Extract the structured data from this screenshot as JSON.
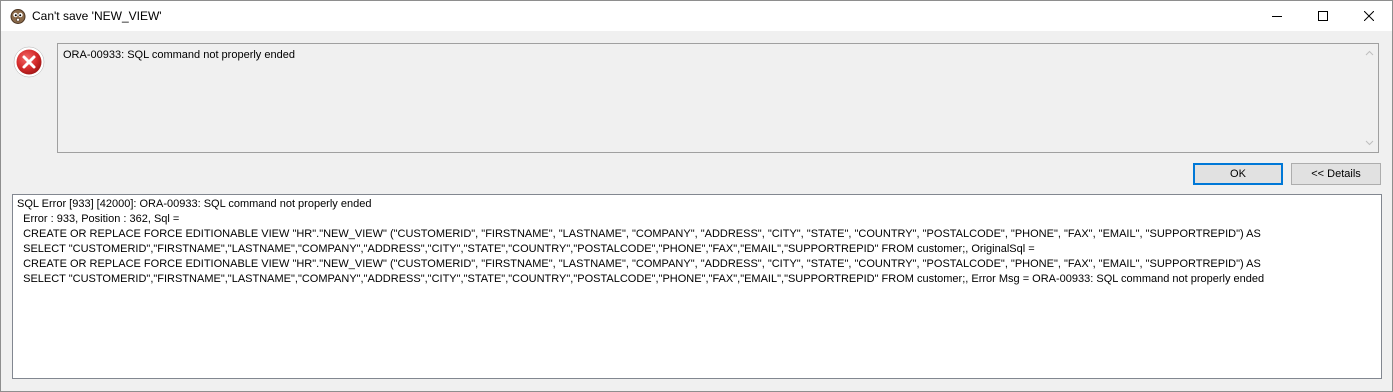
{
  "window": {
    "title": "Can't save 'NEW_VIEW'",
    "controls": {
      "minimize": "minimize-icon",
      "maximize": "maximize-icon",
      "close": "close-icon"
    }
  },
  "message": {
    "icon": "error-icon",
    "text": "ORA-00933: SQL command not properly ended"
  },
  "buttons": {
    "ok_label": "OK",
    "details_label": "<< Details"
  },
  "details": {
    "lines": [
      "SQL Error [933] [42000]: ORA-00933: SQL command not properly ended",
      "  Error : 933, Position : 362, Sql = ",
      "  CREATE OR REPLACE FORCE EDITIONABLE VIEW \"HR\".\"NEW_VIEW\" (\"CUSTOMERID\", \"FIRSTNAME\", \"LASTNAME\", \"COMPANY\", \"ADDRESS\", \"CITY\", \"STATE\", \"COUNTRY\", \"POSTALCODE\", \"PHONE\", \"FAX\", \"EMAIL\", \"SUPPORTREPID\") AS ",
      "  SELECT \"CUSTOMERID\",\"FIRSTNAME\",\"LASTNAME\",\"COMPANY\",\"ADDRESS\",\"CITY\",\"STATE\",\"COUNTRY\",\"POSTALCODE\",\"PHONE\",\"FAX\",\"EMAIL\",\"SUPPORTREPID\" FROM customer;, OriginalSql = ",
      "  CREATE OR REPLACE FORCE EDITIONABLE VIEW \"HR\".\"NEW_VIEW\" (\"CUSTOMERID\", \"FIRSTNAME\", \"LASTNAME\", \"COMPANY\", \"ADDRESS\", \"CITY\", \"STATE\", \"COUNTRY\", \"POSTALCODE\", \"PHONE\", \"FAX\", \"EMAIL\", \"SUPPORTREPID\") AS ",
      "  SELECT \"CUSTOMERID\",\"FIRSTNAME\",\"LASTNAME\",\"COMPANY\",\"ADDRESS\",\"CITY\",\"STATE\",\"COUNTRY\",\"POSTALCODE\",\"PHONE\",\"FAX\",\"EMAIL\",\"SUPPORTREPID\" FROM customer;, Error Msg = ORA-00933: SQL command not properly ended"
    ]
  },
  "colors": {
    "error_red": "#d42a2a",
    "focus_border": "#0078d7",
    "dialog_bg": "#f0f0f0"
  }
}
